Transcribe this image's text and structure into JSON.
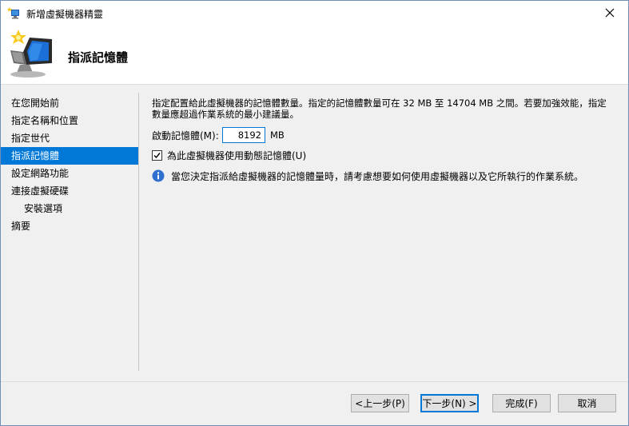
{
  "window": {
    "title": "新增虛擬機器精靈",
    "header_title": "指派記憶體"
  },
  "sidebar": {
    "items": [
      {
        "label": "在您開始前",
        "active": false,
        "sub": false
      },
      {
        "label": "指定名稱和位置",
        "active": false,
        "sub": false
      },
      {
        "label": "指定世代",
        "active": false,
        "sub": false
      },
      {
        "label": "指派記憶體",
        "active": true,
        "sub": false
      },
      {
        "label": "設定網路功能",
        "active": false,
        "sub": false
      },
      {
        "label": "連接虛擬硬碟",
        "active": false,
        "sub": false
      },
      {
        "label": "安裝選項",
        "active": false,
        "sub": true
      },
      {
        "label": "摘要",
        "active": false,
        "sub": false
      }
    ]
  },
  "main": {
    "description": "指定配置給此虛擬機器的記憶體數量。指定的記憶體數量可在 32 MB 至 14704 MB 之間。若要加強效能，指定數量應超過作業系統的最小建議量。",
    "startup_memory_label": "啟動記憶體(M):",
    "startup_memory_value": "8192",
    "memory_unit": "MB",
    "dynamic_memory_label": "為此虛擬機器使用動態記憶體(U)",
    "dynamic_memory_checked": true,
    "info_text": "當您決定指派給虛擬機器的記憶體量時，請考慮想要如何使用虛擬機器以及它所執行的作業系統。"
  },
  "buttons": {
    "previous": "<上一步(P)",
    "next": "下一步(N) >",
    "finish": "完成(F)",
    "cancel": "取消"
  },
  "colors": {
    "accent": "#0078d7",
    "background": "#f0f0f0"
  }
}
